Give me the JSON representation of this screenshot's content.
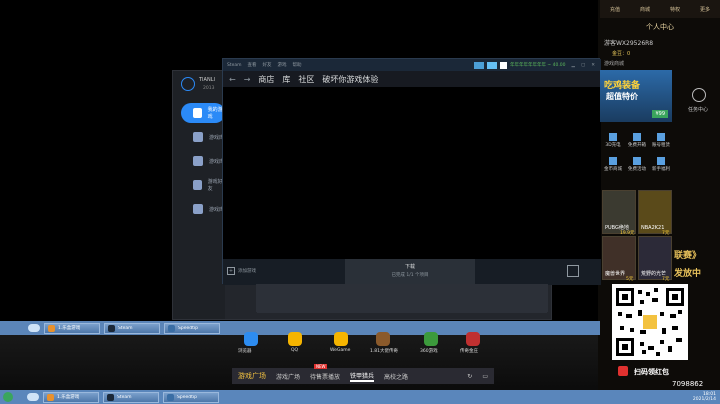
{
  "gamecenter": {
    "title": "TIANLI",
    "id_prefix": "2013",
    "sidebar": [
      {
        "label": "我的游戏",
        "active": true
      },
      {
        "label": "游戏库",
        "active": false
      },
      {
        "label": "游戏库",
        "active": false
      },
      {
        "label": "游戏好友",
        "active": false
      },
      {
        "label": "游戏库",
        "active": false
      }
    ]
  },
  "steam": {
    "menu": [
      "Steam",
      "查看",
      "好友",
      "游戏",
      "帮助"
    ],
    "nav": {
      "store": "商店",
      "library": "库",
      "community": "社区",
      "page": "破坏你游戏体验"
    },
    "account": "年年年年年年年年 ~ 40.00",
    "add_game": "添加游戏",
    "download_title": "下载",
    "download_status": "已完成 1/1 个项目",
    "friends": "好友与聊天"
  },
  "taskbar_inner": [
    {
      "label": "1.乐盒游戏",
      "color": "#e8912d"
    },
    {
      "label": "1.乐盒游戏",
      "color": "#e8912d"
    },
    {
      "label": "Steam",
      "color": "#1b2838"
    },
    {
      "label": "Speedtip",
      "color": "#3a6ea5"
    }
  ],
  "taskbar_outer": [
    {
      "label": "1.乐盒游戏",
      "color": "#e8912d"
    },
    {
      "label": "Steam",
      "color": "#1b2838"
    },
    {
      "label": "Speedtip",
      "color": "#3a6ea5"
    }
  ],
  "right_panel": {
    "top_tabs": [
      "充值",
      "商城",
      "特权",
      "更多"
    ],
    "title": "个人中心",
    "user": "游客WX29526R8",
    "gold": "金豆：0",
    "shop_label": "游戏商城",
    "banner_line1": "吃鸡装备",
    "banner_line2": "超值特价",
    "banner_price": "¥99",
    "grid": [
      "3D充电",
      "免费开箱",
      "账号租赁",
      "金币商城",
      "免费活动",
      "新手福利"
    ],
    "games": [
      {
        "name": "PUBG绝地",
        "tag": "19.9元"
      },
      {
        "name": "NBA2K21",
        "tag": "7元"
      },
      {
        "name": "魔兽世界",
        "tag": "5元"
      },
      {
        "name": "荒野的光芒",
        "tag": "7元"
      }
    ],
    "side_text": "任务中心",
    "promo": "扫码领红包",
    "banner_right1": "联赛》",
    "banner_right2": "发放中",
    "number": "7098862",
    "clock_time": "18:01",
    "clock_date": "2021/2/14"
  },
  "launcher": {
    "logo": "游戏广场",
    "tabs": [
      "游戏广场",
      "待售票播放",
      "铁甲猎兵",
      "高校之路"
    ],
    "active_index": 2,
    "new_badge": "NEW"
  },
  "dock": [
    {
      "label": "浏览器",
      "color": "#2d8cf0"
    },
    {
      "label": "QQ",
      "color": "#ffffff"
    },
    {
      "label": "WeGame",
      "color": "#f5b400"
    },
    {
      "label": "1.81大佬传奇",
      "color": "#8b5a2b"
    },
    {
      "label": "360游戏",
      "color": "#3c9a3c"
    },
    {
      "label": "传奇金庄",
      "color": "#c03030"
    }
  ]
}
